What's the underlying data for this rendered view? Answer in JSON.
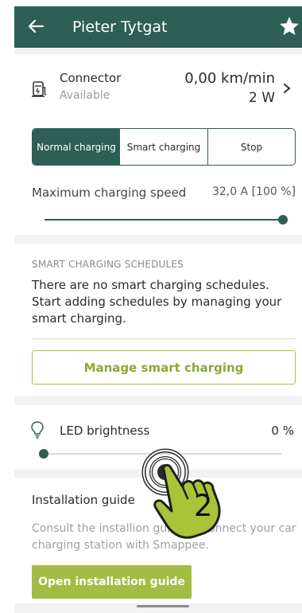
{
  "header": {
    "title": "Pieter Tytgat",
    "back_icon": "arrow-back-icon",
    "favorite_icon": "star-icon"
  },
  "connector": {
    "name": "Connector",
    "status": "Available",
    "speed": "0,00 km/min",
    "power": "2 W",
    "icon": "charging-station-icon"
  },
  "charging_modes": {
    "normal": "Normal charging",
    "smart": "Smart charging",
    "stop": "Stop",
    "selected": "Normal charging"
  },
  "max_speed": {
    "label": "Maximum charging speed",
    "value": "32,0 A [100 %]",
    "level_percent": 100
  },
  "schedules": {
    "section_title": "SMART CHARGING SCHEDULES",
    "empty_text": "There are no smart charging schedules. Start adding schedules by managing your smart charging.",
    "manage_button": "Manage smart charging"
  },
  "led": {
    "label": "LED brightness",
    "value": "0 %",
    "level_percent": 0,
    "icon": "lightbulb-icon"
  },
  "installation": {
    "title": "Installation guide",
    "text": "Consult the installion guide to connect your car charging station with Smappee.",
    "button": "Open installation guide"
  },
  "annotation": {
    "step_number": "2",
    "icon": "tap-hand-icon"
  },
  "colors": {
    "primary": "#2e5f55",
    "accent": "#a2bc44",
    "background": "#f2f2f2"
  }
}
